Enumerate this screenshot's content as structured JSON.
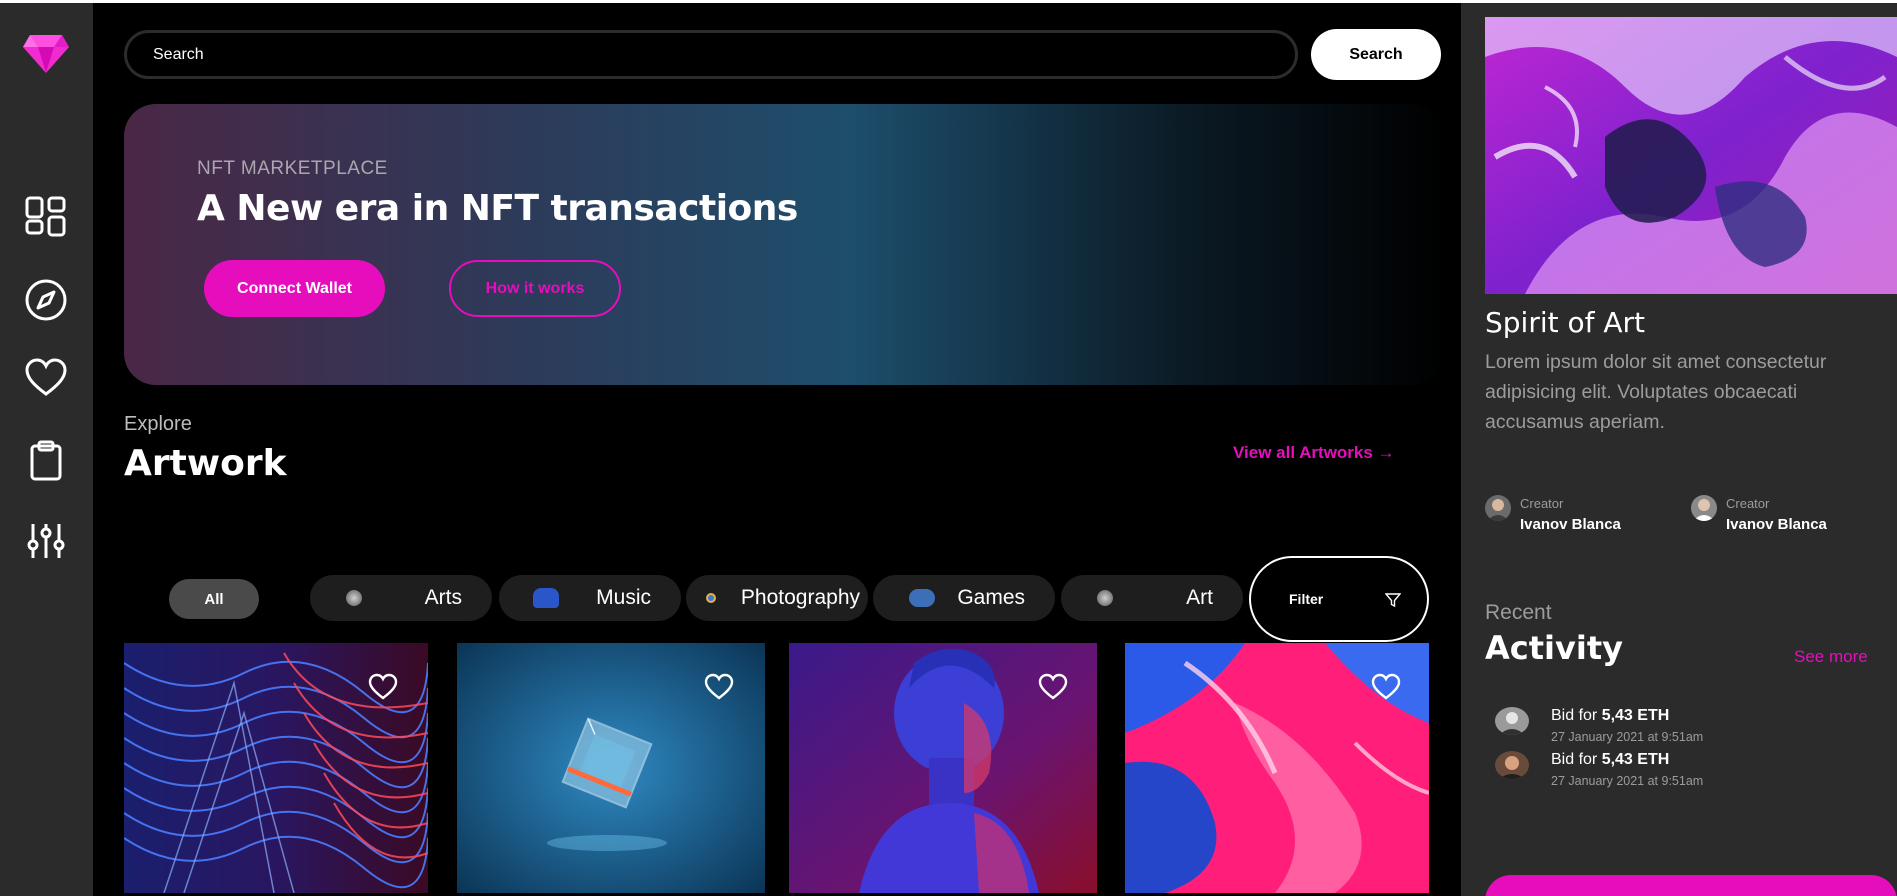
{
  "search": {
    "placeholder": "Search",
    "button_label": "Search"
  },
  "sidebar": {
    "logo": "diamond-logo",
    "items": [
      {
        "icon": "dashboard-icon"
      },
      {
        "icon": "compass-icon"
      },
      {
        "icon": "heart-icon"
      },
      {
        "icon": "clipboard-icon"
      },
      {
        "icon": "sliders-icon"
      }
    ]
  },
  "hero": {
    "eyebrow": "NFT MARKETPLACE",
    "title": "A New era in NFT transactions",
    "connect_label": "Connect Wallet",
    "how_label": "How it works"
  },
  "explore": {
    "eyebrow": "Explore",
    "title": "Artwork",
    "view_all": "View all Artworks →"
  },
  "categories": [
    {
      "label": "All"
    },
    {
      "label": "Arts"
    },
    {
      "label": "Music"
    },
    {
      "label": "Photography"
    },
    {
      "label": "Games"
    },
    {
      "label": "Art"
    }
  ],
  "filter": {
    "label": "Filter"
  },
  "artworks": [
    {
      "name": "artwork-waves"
    },
    {
      "name": "artwork-cube"
    },
    {
      "name": "artwork-statue"
    },
    {
      "name": "artwork-paint"
    }
  ],
  "featured": {
    "title": "Spirit of Art",
    "description": "Lorem ipsum dolor sit amet consectetur adipisicing elit. Voluptates obcaecati accusamus aperiam.",
    "creators": [
      {
        "role": "Creator",
        "name": "Ivanov Blanca"
      },
      {
        "role": "Creator",
        "name": "Ivanov Blanca"
      }
    ]
  },
  "activity": {
    "eyebrow": "Recent",
    "title": "Activity",
    "see_more": "See more",
    "items": [
      {
        "prefix": "Bid for ",
        "amount": "5,43 ETH",
        "time": "27 January 2021 at 9:51am"
      },
      {
        "prefix": "Bid for ",
        "amount": "5,43 ETH",
        "time": "27 January 2021 at 9:51am"
      }
    ]
  },
  "colors": {
    "accent": "#e60dbd",
    "sidebar": "#2b2b2b",
    "background": "#000000"
  }
}
